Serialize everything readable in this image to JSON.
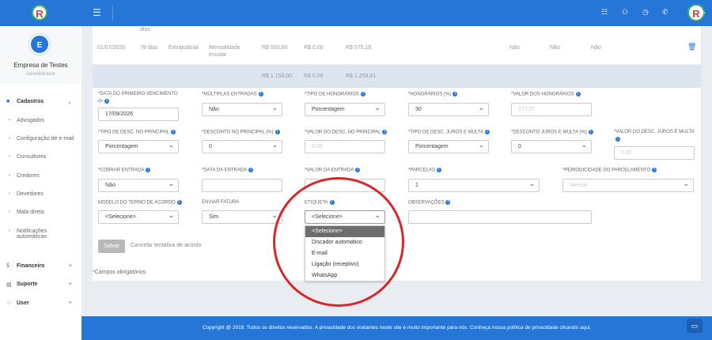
{
  "topbar": {
    "logo_letter": "R",
    "menu_icon": "☰",
    "avatar_letter": "R"
  },
  "sidebar": {
    "avatar_letter": "E",
    "company": "Empresa de Testes",
    "role": "Administrador",
    "section_cadastros": "Cadastros",
    "items": [
      "Advogados",
      "Configuração de e-mail",
      "Consultores",
      "Credores",
      "Devedores",
      "Mala direta",
      "Notificações",
      "automáticas"
    ],
    "section_financeiro": "Financeiro",
    "section_suporte": "Suporte",
    "section_user": "User"
  },
  "table": {
    "top_partial": "dias",
    "row1": {
      "date": "01/07/2026",
      "days": "78 dias",
      "type": "Extrajudicial",
      "desc1": "Mensalidade",
      "desc2": "escolar",
      "v1": "R$ 550,00",
      "v2": "R$ 0,00",
      "v3": "R$ 575,16",
      "n1": "Não",
      "n2": "Não",
      "n3": "Não"
    },
    "totals": {
      "t1": "R$ 1.150,00",
      "t2": "R$ 0,00",
      "t3": "R$ 1.259,81"
    }
  },
  "form": {
    "data_primeiro_vencimento_label": "*Data do primeiro vencimento",
    "data_primeiro_vencimento": "17/09/2026",
    "multiplas_entradas_label": "*Múltiplas entradas",
    "multiplas_entradas": "Não",
    "tipo_honorarios_label": "*Tipo de honorários",
    "tipo_honorarios": "Porcentagem",
    "honorarios_label": "*Honorários (%)",
    "honorarios": "30",
    "valor_honorarios_label": "*Valor dos honorários",
    "valor_honorarios_ph": "377,97",
    "tipo_desc_principal_label": "*Tipo de desc. no principal",
    "tipo_desc_principal": "Porcentagem",
    "desconto_principal_label": "*Desconto no principal (%)",
    "desconto_principal": "0",
    "valor_desc_principal_label": "*Valor do desc. no principal",
    "valor_desc_principal_ph": "0,00",
    "tipo_desc_juros_label": "*Tipo de desc. juros e multa",
    "tipo_desc_juros": "Porcentagem",
    "desconto_juros_label": "*Desconto juros e multa (%)",
    "desconto_juros": "0",
    "valor_desc_juros_label": "*Valor do desc. juros e multa",
    "valor_desc_juros_ph": "0,00",
    "cobrar_entrada_label": "*Cobrar entrada",
    "cobrar_entrada": "Não",
    "data_entrada_label": "*Data da entrada",
    "valor_entrada_label": "*Valor da entrada",
    "parcelas_label": "*Parcelas",
    "parcelas": "1",
    "periodicidade_label": "*Periodicidade do parcelamento",
    "periodicidade_ph": "Mensal",
    "modelo_termo_label": "Modelo do termo de acordo",
    "modelo_termo": "<Selecione>",
    "enviar_fatura_label": "Enviar fatura",
    "enviar_fatura": "Sim",
    "etiqueta_label": "Etiqueta",
    "etiqueta": "<Selecione>",
    "observacoes_label": "Observações",
    "etiqueta_options": [
      "<Selecione>",
      "Discador automático",
      "E-mail",
      "Ligação (receptivo)",
      "WhatsApp"
    ],
    "save_label": "Salvar",
    "cancel_label": "Cancelar tentativa de acordo",
    "required_note": "*Campos obrigatórios"
  },
  "footer": {
    "text": "Copyright @ 2019. Todos os direitos reservados. A privacidade dos visitantes neste site é muito importante para nós. Conheça nossa política de privacidade clicando aqui."
  },
  "colors": {
    "primary": "#2576d6",
    "annotation": "#d9262b"
  }
}
